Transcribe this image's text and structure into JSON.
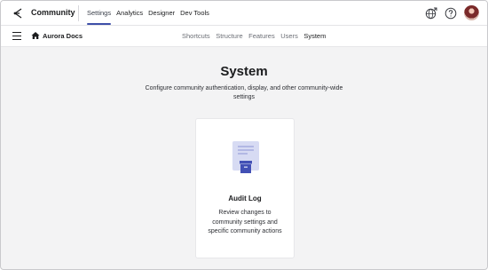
{
  "topbar": {
    "icons": {
      "logo": "community-logo-icon",
      "globe": "globe-icon",
      "help": "help-icon"
    },
    "app_title": "Community",
    "nav": [
      {
        "label": "Settings",
        "active": true
      },
      {
        "label": "Analytics",
        "active": false
      },
      {
        "label": "Designer",
        "active": false
      },
      {
        "label": "Dev Tools",
        "active": false
      }
    ]
  },
  "subbar": {
    "icons": {
      "menu": "hamburger-icon",
      "home": "home-icon"
    },
    "breadcrumb": "Aurora Docs",
    "tabs": [
      {
        "label": "Shortcuts",
        "active": false
      },
      {
        "label": "Structure",
        "active": false
      },
      {
        "label": "Features",
        "active": false
      },
      {
        "label": "Users",
        "active": false
      },
      {
        "label": "System",
        "active": true
      }
    ]
  },
  "main": {
    "title": "System",
    "description": "Configure community authentication, display, and other community-wide settings",
    "cards": [
      {
        "icon": "audit-log-icon",
        "title": "Audit Log",
        "description": "Review changes to community settings and specific community actions"
      }
    ]
  },
  "colors": {
    "accent": "#3e4fa8",
    "page_background": "#f3f3f4",
    "icon_light": "#d7dbf3",
    "icon_dark": "#4250b5"
  }
}
